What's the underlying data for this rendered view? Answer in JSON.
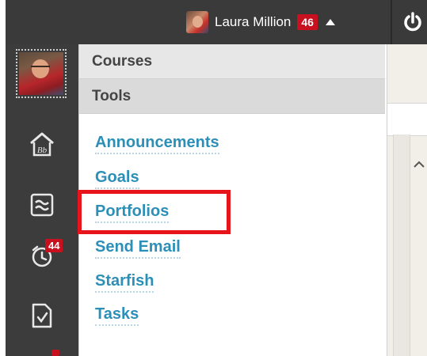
{
  "header": {
    "user_name": "Laura Million",
    "notification_count": "46"
  },
  "rail": {
    "calendar_badge": "44"
  },
  "menu": {
    "sections": {
      "courses": "Courses",
      "tools": "Tools"
    },
    "tools": [
      {
        "label": "Announcements"
      },
      {
        "label": "Goals"
      },
      {
        "label": "Portfolios"
      },
      {
        "label": "Send Email"
      },
      {
        "label": "Starfish"
      },
      {
        "label": "Tasks"
      }
    ],
    "highlighted_item": "Portfolios"
  },
  "colors": {
    "topbar": "#3a3a3a",
    "rail": "#3c3c3c",
    "link": "#2b8fb7",
    "badge": "#c8101e",
    "highlight": "#e8141c"
  },
  "icons": [
    "power-icon",
    "home-icon",
    "stream-icon",
    "calendar-icon",
    "grades-icon",
    "caret-up-icon",
    "chevron-up-icon"
  ]
}
